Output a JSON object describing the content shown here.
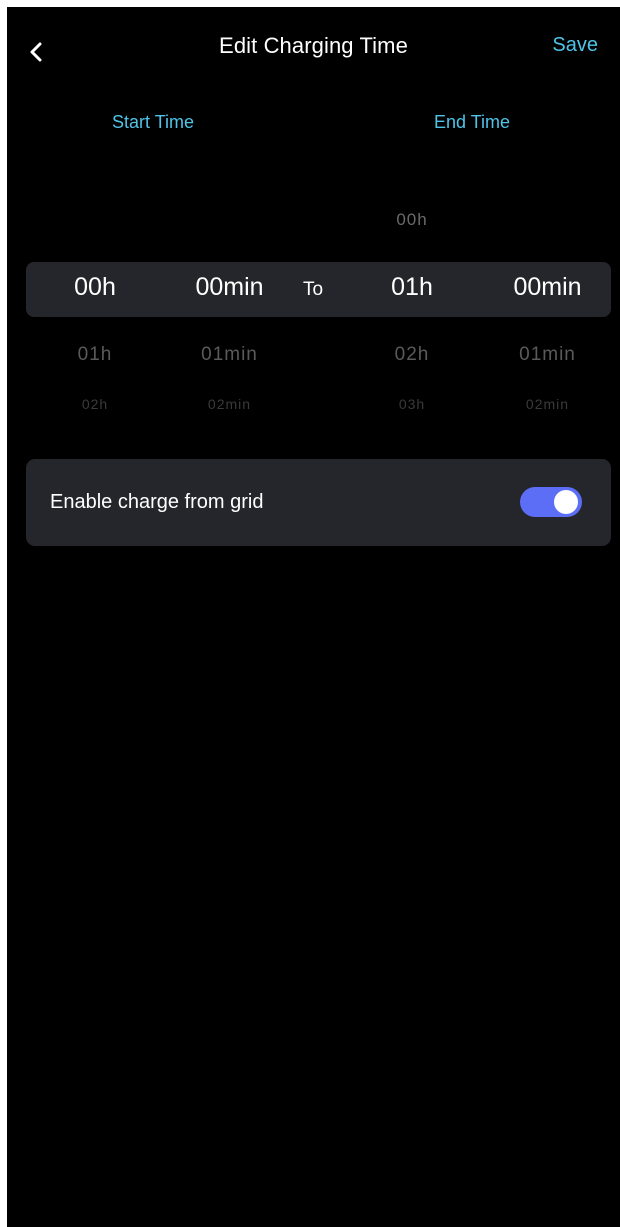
{
  "header": {
    "title": "Edit Charging Time",
    "save_label": "Save",
    "back_icon": "chevron-left-icon"
  },
  "labels": {
    "start_time": "Start Time",
    "end_time": "End Time",
    "to": "To"
  },
  "pickers": {
    "start_hour": {
      "selected": "00h",
      "below": [
        "01h",
        "02h"
      ]
    },
    "start_minute": {
      "selected": "00min",
      "below": [
        "01min",
        "02min"
      ]
    },
    "end_hour": {
      "above": "00h",
      "selected": "01h",
      "below": [
        "02h",
        "03h"
      ]
    },
    "end_minute": {
      "selected": "00min",
      "below": [
        "01min",
        "02min"
      ]
    }
  },
  "grid_charge": {
    "label": "Enable charge from grid",
    "enabled": true,
    "toggle_color": "#5c6ef5"
  },
  "colors": {
    "accent": "#4fc3e8",
    "background": "#000000",
    "card": "#25262b"
  }
}
